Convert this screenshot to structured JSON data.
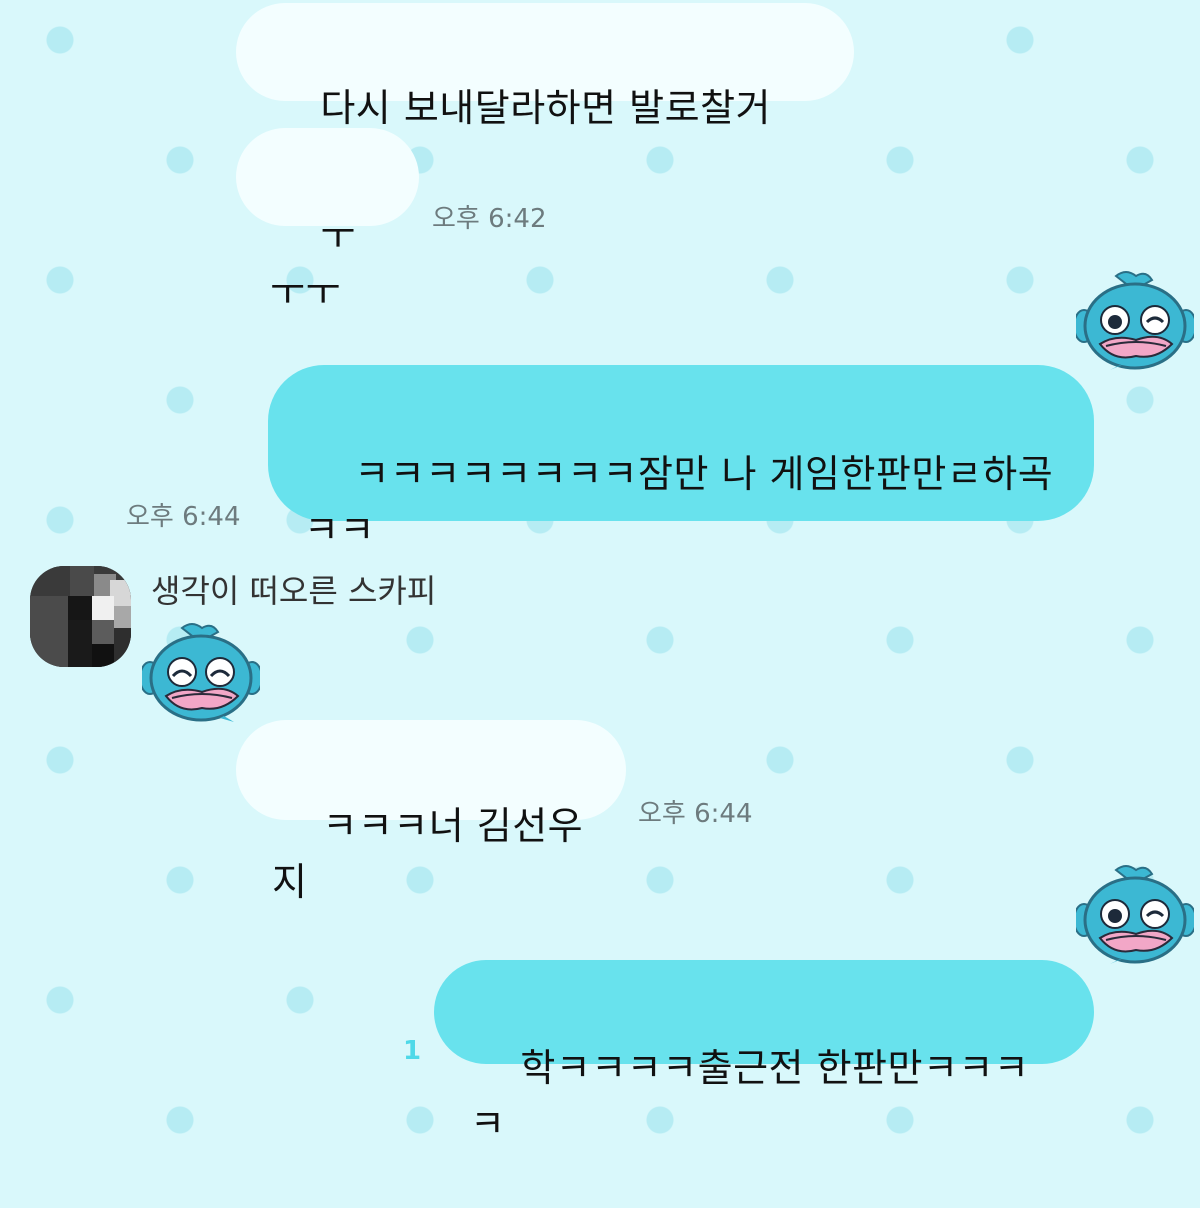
{
  "messages": [
    {
      "id": "m1",
      "side": "in",
      "text": "다시 보내달라하면 발로찰거임?"
    },
    {
      "id": "m2",
      "side": "in",
      "text": "ㅜㅜㅜ",
      "time": "오후 6:42"
    },
    {
      "id": "m3",
      "side": "out",
      "text": "ㅋㅋㅋㅋㅋㅋㅋㅋ잠만 나 게임한판만ㄹ하곡\nㅋㅋ",
      "time": "오후 6:44"
    },
    {
      "id": "m4",
      "side": "in",
      "sender": "생각이 떠오른 스카피",
      "text": "ㅋㅋㅋ너 김선우지",
      "time": "오후 6:44"
    },
    {
      "id": "m5",
      "side": "out",
      "text": "학ㅋㅋㅋㅋ출근전 한판만ㅋㅋㅋㅋ",
      "unread": "1"
    }
  ],
  "stickers": {
    "icon": "fish-character-sticker",
    "body_color": "#3cb8d3",
    "lip_color": "#f2a7c7"
  },
  "colors": {
    "background": "#d9f8fb",
    "incoming_bubble": "#f3feff",
    "outgoing_bubble": "#68e2ed",
    "timestamp": "#6d7b7e",
    "unread": "#4fd9e8"
  }
}
